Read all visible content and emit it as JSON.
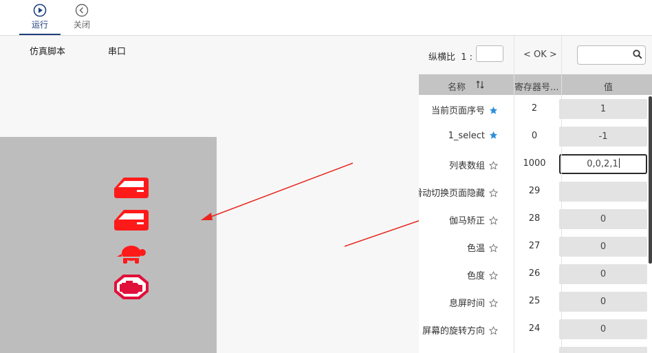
{
  "toolbar": {
    "run_label": "运行",
    "close_label": "关闭"
  },
  "tabs": [
    "仿真脚本",
    "串口"
  ],
  "preview": {
    "icons": [
      "door-open-icon",
      "door-open-icon",
      "turtle-icon",
      "engine-icon"
    ],
    "icon_color": "#ff1a1a",
    "engine_color": "#e0103a",
    "background": "#bdbdbd"
  },
  "panel": {
    "aspect_label": "纵横比",
    "aspect_value_prefix": "1 :",
    "ok_label": "< OK >",
    "search_placeholder": "",
    "columns": {
      "name": "名称",
      "register": "寄存器号...",
      "value": "值"
    },
    "rows": [
      {
        "name": "当前页面序号",
        "starred": true,
        "register": "2",
        "value": "1"
      },
      {
        "name": "1_select",
        "starred": true,
        "register": "0",
        "value": "-1"
      },
      {
        "name": "列表数组",
        "starred": false,
        "register": "1000",
        "value": "0,0,2,1",
        "editing": true
      },
      {
        "name": "滑动切换页面隐藏",
        "starred": false,
        "register": "29",
        "value": ""
      },
      {
        "name": "伽马矫正",
        "starred": false,
        "register": "28",
        "value": "0"
      },
      {
        "name": "色温",
        "starred": false,
        "register": "27",
        "value": "0"
      },
      {
        "name": "色度",
        "starred": false,
        "register": "26",
        "value": "0"
      },
      {
        "name": "息屏时间",
        "starred": false,
        "register": "25",
        "value": "0"
      },
      {
        "name": "屏幕的旋转方向",
        "starred": false,
        "register": "24",
        "value": "0"
      },
      {
        "name": "",
        "starred": false,
        "register": "",
        "value": ""
      }
    ],
    "star_color": "#2e8fd8"
  }
}
